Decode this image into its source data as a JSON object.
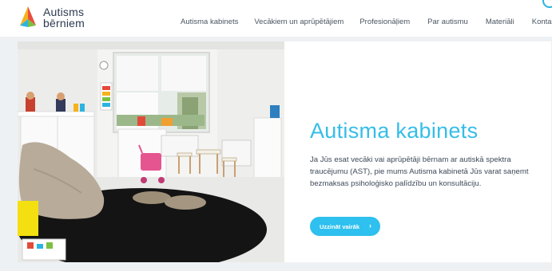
{
  "logo": {
    "line1": "Autisms",
    "line2": "bērniem"
  },
  "nav": [
    {
      "label": "Autisma kabinets"
    },
    {
      "label": "Vecākiem un aprūpētājiem"
    },
    {
      "label": "Profesionāļiem"
    },
    {
      "label": "Par autismu"
    },
    {
      "label": "Materiāli"
    },
    {
      "label": "Kontakti"
    }
  ],
  "hero": {
    "title": "Autisma kabinets",
    "text": "Ja Jūs esat vecāki vai aprūpētāji bērnam ar autiskā spektra traucējumu (AST), pie mums Autisma kabinetā Jūs varat saņemt bezmaksas psiholoģisko palīdzību un konsultāciju.",
    "cta_label": "Uzzināt vairāk",
    "cta_icon": "chevron-right-icon"
  },
  "colors": {
    "accent": "#36bde8",
    "button": "#2ec0ee",
    "text": "#3d4a58"
  }
}
